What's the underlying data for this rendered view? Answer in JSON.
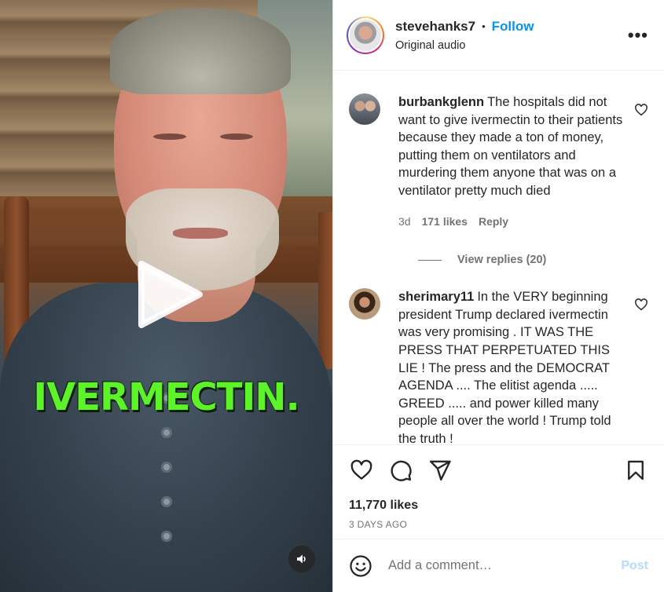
{
  "post": {
    "username": "stevehanks7",
    "dot": "•",
    "follow_label": "Follow",
    "audio_label": "Original audio",
    "more_label": "•••"
  },
  "video": {
    "caption_overlay": "IVERMECTIN.",
    "play_icon": "play-icon",
    "mute_icon": "speaker-icon"
  },
  "comments": [
    {
      "username": "burbankglenn",
      "text": "The hospitals did not want to give ivermectin to their patients because they made a ton of money, putting them on ventilators and murdering them anyone that was on a ventilator pretty much died",
      "age": "3d",
      "likes": "171 likes",
      "reply_label": "Reply",
      "view_replies": "View replies (20)"
    },
    {
      "username": "sherimary11",
      "text": "In the VERY beginning president Trump declared ivermectin was very promising . IT WAS THE PRESS THAT PERPETUATED THIS LIE ! The press and the DEMOCRAT AGENDA .... The elitist agenda ..... GREED ..... and power killed many people all over the world ! Trump told the truth !"
    }
  ],
  "actions": {
    "likes": "11,770 likes",
    "posted": "3 DAYS AGO"
  },
  "add_comment": {
    "placeholder": "Add a comment…",
    "post_label": "Post"
  },
  "colors": {
    "accent": "#0095f6",
    "post_disabled": "#b3dbff",
    "caption_green": "#5ef22a"
  }
}
